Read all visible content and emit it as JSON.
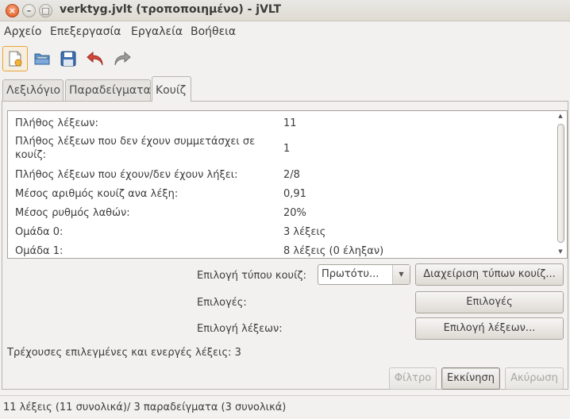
{
  "window": {
    "title": "verktyg.jvlt (τροποποιημένο) - jVLT"
  },
  "menubar": {
    "items": [
      "Αρχείο",
      "Επεξεργασία",
      "Εργαλεία",
      "Βοήθεια"
    ]
  },
  "toolbar": {
    "icons": [
      "new-file-icon",
      "open-folder-icon",
      "save-icon",
      "undo-icon",
      "redo-icon"
    ]
  },
  "tabs": [
    {
      "label": "Λεξιλόγιο",
      "selected": false
    },
    {
      "label": "Παραδείγματα",
      "selected": false
    },
    {
      "label": "Κουίζ",
      "selected": true
    }
  ],
  "stats": [
    {
      "label": "Πλήθος λέξεων:",
      "value": "11"
    },
    {
      "label": "Πλήθος λέξεων που δεν έχουν συμμετάσχει σε κουίζ:",
      "value": "1"
    },
    {
      "label": "Πλήθος λέξεων που έχουν/δεν έχουν λήξει:",
      "value": "2/8"
    },
    {
      "label": "Μέσος αριθμός κουίζ ανα λέξη:",
      "value": "0,91"
    },
    {
      "label": "Μέσος ρυθμός λαθών:",
      "value": "20%"
    },
    {
      "label": "Ομάδα 0:",
      "value": "3 λέξεις"
    },
    {
      "label": "Ομάδα 1:",
      "value": "8 λέξεις (0 έληξαν)"
    }
  ],
  "quiz_type": {
    "label": "Επιλογή τύπου κουίζ:",
    "selected": "Πρωτότυ...",
    "manage_button": "Διαχείριση τύπων κουίζ..."
  },
  "options": {
    "label": "Επιλογές:",
    "button": "Επιλογές"
  },
  "word_selection": {
    "label": "Επιλογή λέξεων:",
    "button": "Επιλογή λέξεων..."
  },
  "current_selection_text": "Τρέχουσες επιλεγμένες και ενεργές λέξεις: 3",
  "actions": {
    "filter": "Φίλτρο",
    "start": "Εκκίνηση",
    "cancel": "Ακύρωση"
  },
  "statusbar": {
    "text": "11 λέξεις (11 συνολικά)/ 3 παραδείγματα (3 συνολικά)"
  }
}
